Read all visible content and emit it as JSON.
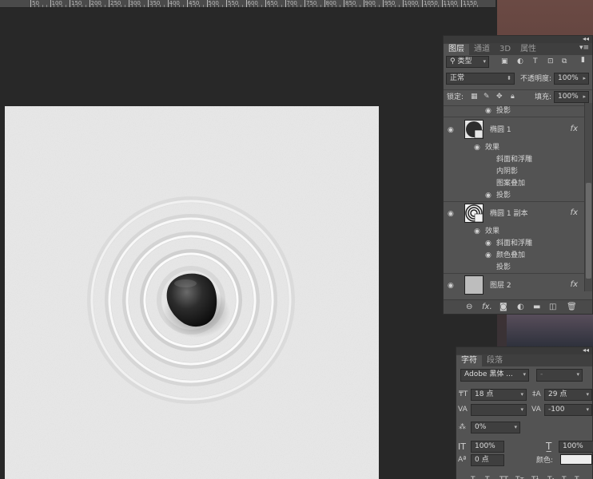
{
  "ruler": {
    "labels": [
      "50",
      "100",
      "150",
      "200",
      "250",
      "300",
      "350",
      "400",
      "450",
      "500",
      "550",
      "600",
      "650",
      "700",
      "750",
      "800",
      "850",
      "900",
      "950",
      "1000",
      "1050",
      "1100",
      "1150"
    ]
  },
  "layers_panel": {
    "tabs": [
      "图层",
      "通道",
      "3D",
      "属性"
    ],
    "filter_kind": "类型",
    "blend_mode": "正常",
    "opacity_label": "不透明度:",
    "opacity_value": "100%",
    "lock_label": "锁定:",
    "fill_label": "填充:",
    "fill_value": "100%",
    "top_effect": "投影",
    "layers": [
      {
        "name": "椭圆 1",
        "fx": "fx",
        "effects_label": "效果",
        "effects": [
          "斜面和浮雕",
          "内阴影",
          "图案叠加",
          "投影"
        ]
      },
      {
        "name": "椭圆 1 副本",
        "fx": "fx",
        "effects_label": "效果",
        "effects": [
          "斜面和浮雕",
          "颜色叠加",
          "投影"
        ]
      },
      {
        "name": "图层 2",
        "fx": "fx"
      }
    ],
    "bottom_icons": [
      "link-icon",
      "fx-icon",
      "mask-icon",
      "adjustment-icon",
      "group-icon",
      "new-layer-icon",
      "trash-icon"
    ]
  },
  "char_panel": {
    "tabs": [
      "字符",
      "段落"
    ],
    "font_family": "Adobe 黑体 ...",
    "font_style": "-",
    "font_size": "18 点",
    "leading": "29 点",
    "kerning": "",
    "tracking": "-100",
    "baseline_scale": "0%",
    "vertical_scale": "100%",
    "horizontal_scale": "100%",
    "baseline_shift": "0 点",
    "color_label": "颜色:",
    "color_value": "#ededed"
  }
}
